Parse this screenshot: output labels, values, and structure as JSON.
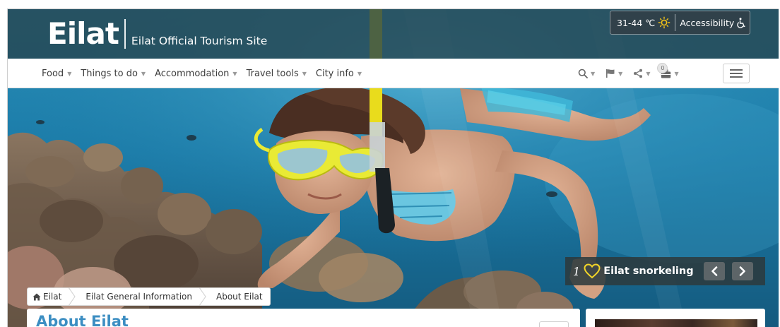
{
  "header": {
    "logo_text": "Eilat",
    "tagline": "Eilat Official Tourism Site",
    "weather": "31-44 ℃",
    "accessibility_label": "Accessibility"
  },
  "nav": {
    "items": [
      {
        "label": "Food"
      },
      {
        "label": "Things to do"
      },
      {
        "label": "Accommodation"
      },
      {
        "label": "Travel tools"
      },
      {
        "label": "City info"
      }
    ],
    "trip_count": "0"
  },
  "slide": {
    "index": "1",
    "title": "Eilat snorkeling"
  },
  "breadcrumb": [
    {
      "label": "Eilat"
    },
    {
      "label": "Eilat General Information"
    },
    {
      "label": "About Eilat"
    }
  ],
  "page": {
    "title": "About Eilat"
  },
  "icons": {
    "weather": "sun-icon",
    "accessibility": "wheelchair-icon",
    "search": "search-icon",
    "language": "flag-icon",
    "share": "share-icon",
    "trip": "suitcase-icon",
    "menu": "hamburger-icon",
    "favorite": "heart-icon",
    "home": "home-icon"
  },
  "colors": {
    "header_bg": "#26434e",
    "link_blue": "#3c8ec2",
    "sun": "#f2c318",
    "heart": "#f3d628",
    "water": "#1a6f99"
  }
}
